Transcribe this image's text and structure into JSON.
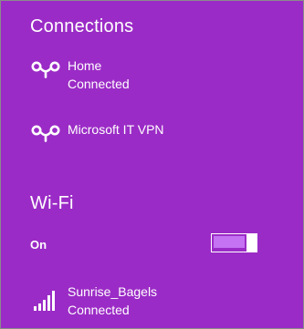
{
  "connections": {
    "title": "Connections",
    "items": [
      {
        "name": "Home",
        "status": "Connected",
        "icon": "link-icon"
      },
      {
        "name": "Microsoft IT VPN",
        "status": "",
        "icon": "link-icon"
      }
    ]
  },
  "wifi": {
    "title": "Wi-Fi",
    "toggle_label": "On",
    "toggle_state": "on",
    "networks": [
      {
        "name": "Sunrise_Bagels",
        "status": "Connected",
        "icon": "wifi-signal-icon",
        "signal_bars": 5
      }
    ]
  },
  "colors": {
    "background": "#9b2bc6",
    "toggle_fill": "#c572f3",
    "text": "#ffffff"
  }
}
